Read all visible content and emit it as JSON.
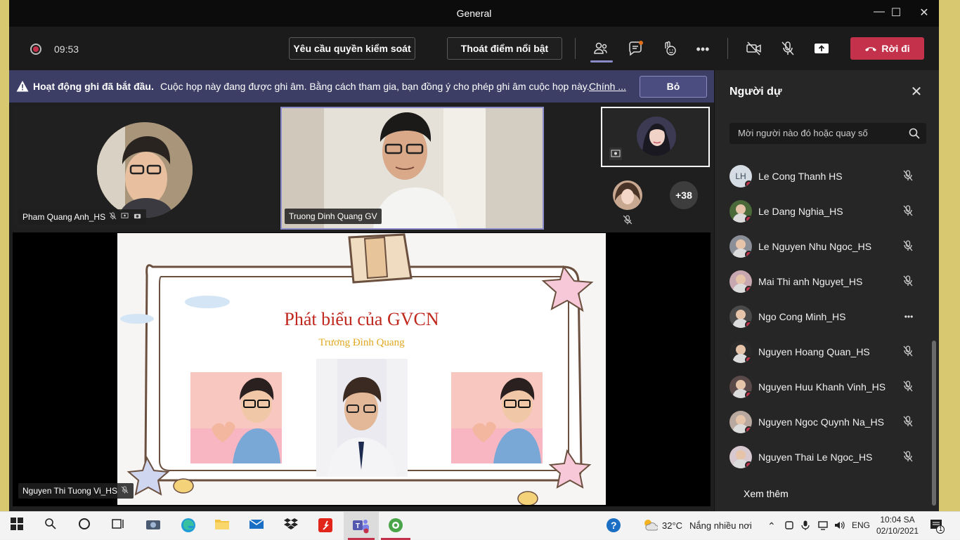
{
  "window": {
    "title": "General"
  },
  "toolbar": {
    "timer": "09:53",
    "request_control": "Yêu cầu quyền kiểm soát",
    "exit_spotlight": "Thoát điểm nổi bật",
    "leave": "Rời đi"
  },
  "banner": {
    "heading": "Hoạt động ghi đã bắt đầu.",
    "message": "Cuộc họp này đang được ghi âm. Bằng cách tham gia, bạn đồng ý cho phép ghi âm cuộc họp này.",
    "link": "Chính ...",
    "dismiss": "Bỏ"
  },
  "stage": {
    "tile1_name": "Pham Quang Anh_HS",
    "tile2_name": "Truong Dinh Quang GV",
    "overflow_count": "+38",
    "presenter_name": "Nguyen Thi Tuong Vi_HS"
  },
  "slide": {
    "title": "Phát biểu của GVCN",
    "subtitle": "Trương Đình Quang"
  },
  "panel": {
    "title": "Người dự",
    "search_placeholder": "Mời người nào đó hoặc quay số",
    "participants": [
      {
        "name": "Le Cong Thanh HS",
        "initials": "LH",
        "status": "muted"
      },
      {
        "name": "Le Dang Nghia_HS",
        "initials": "",
        "status": "muted"
      },
      {
        "name": "Le Nguyen Nhu Ngoc_HS",
        "initials": "",
        "status": "muted"
      },
      {
        "name": "Mai Thi anh Nguyet_HS",
        "initials": "",
        "status": "muted"
      },
      {
        "name": "Ngo Cong Minh_HS",
        "initials": "",
        "status": "more"
      },
      {
        "name": "Nguyen Hoang Quan_HS",
        "initials": "",
        "status": "muted"
      },
      {
        "name": "Nguyen Huu Khanh Vinh_HS",
        "initials": "",
        "status": "muted"
      },
      {
        "name": "Nguyen Ngoc Quynh Na_HS",
        "initials": "",
        "status": "muted"
      },
      {
        "name": "Nguyen Thai Le Ngoc_HS",
        "initials": "",
        "status": "muted"
      }
    ],
    "see_more": "Xem thêm"
  },
  "taskbar": {
    "temperature": "32°C",
    "weather": "Nắng nhiều nơi",
    "language": "ENG",
    "time": "10:04 SA",
    "date": "02/10/2021",
    "notification_count": "1"
  },
  "colors": {
    "accent": "#c4314b",
    "banner": "#3d3e66",
    "spotlight_border": "#8b8cc7"
  }
}
